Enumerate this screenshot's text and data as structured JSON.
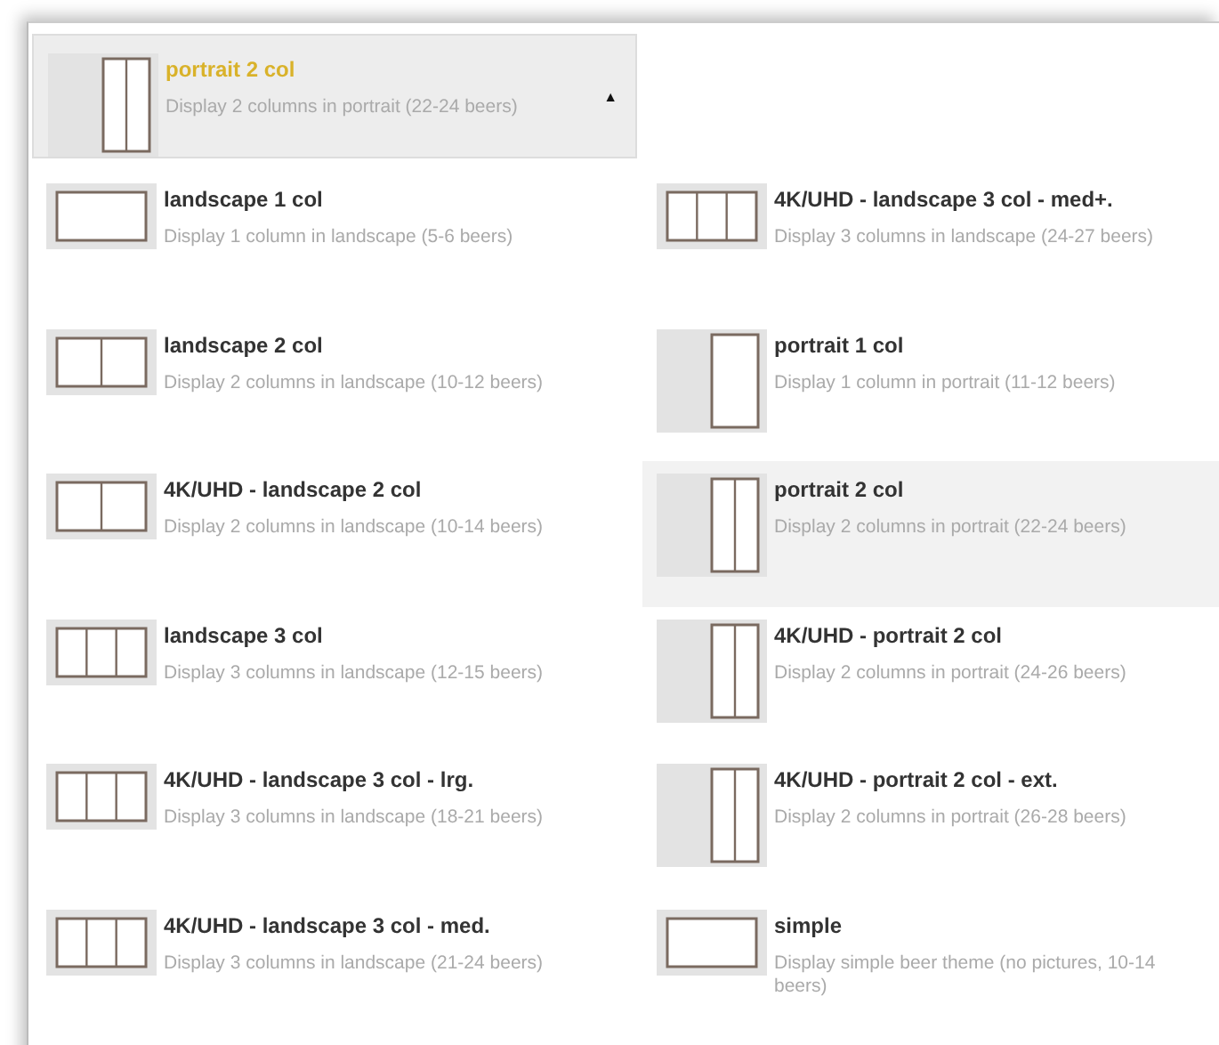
{
  "dropdown": {
    "kind": "portrait2",
    "title": "portrait 2 col",
    "description": "Display 2 columns in portrait (22-24 beers)",
    "arrow": "▲"
  },
  "options": [
    {
      "kind": "landscape1",
      "title": "landscape 1 col",
      "description": "Display 1 column in landscape (5-6 beers)",
      "selected": false
    },
    {
      "kind": "landscape3",
      "title": "4K/UHD - landscape 3 col - med+.",
      "description": "Display 3 columns in landscape (24-27 beers)",
      "selected": false
    },
    {
      "kind": "landscape2",
      "title": "landscape 2 col",
      "description": "Display 2 columns in landscape (10-12 beers)",
      "selected": false
    },
    {
      "kind": "portrait1",
      "title": "portrait 1 col",
      "description": "Display 1 column in portrait (11-12 beers)",
      "selected": false
    },
    {
      "kind": "landscape2",
      "title": "4K/UHD - landscape 2 col",
      "description": "Display 2 columns in landscape (10-14 beers)",
      "selected": false
    },
    {
      "kind": "portrait2",
      "title": "portrait 2 col",
      "description": "Display 2 columns in portrait (22-24 beers)",
      "selected": true
    },
    {
      "kind": "landscape3",
      "title": "landscape 3 col",
      "description": "Display 3 columns in landscape (12-15 beers)",
      "selected": false
    },
    {
      "kind": "portrait2",
      "title": "4K/UHD - portrait 2 col",
      "description": "Display 2 columns in portrait (24-26 beers)",
      "selected": false
    },
    {
      "kind": "landscape3",
      "title": "4K/UHD - landscape 3 col - lrg.",
      "description": "Display 3 columns in landscape (18-21 beers)",
      "selected": false
    },
    {
      "kind": "portrait2",
      "title": "4K/UHD - portrait 2 col - ext.",
      "description": "Display 2 columns in portrait (26-28 beers)",
      "selected": false
    },
    {
      "kind": "landscape3",
      "title": "4K/UHD - landscape 3 col - med.",
      "description": "Display 3 columns in landscape (21-24 beers)",
      "selected": false
    },
    {
      "kind": "landscape1",
      "title": "simple",
      "description": "Display simple beer theme (no pictures, 10-14 beers)",
      "selected": false
    }
  ]
}
